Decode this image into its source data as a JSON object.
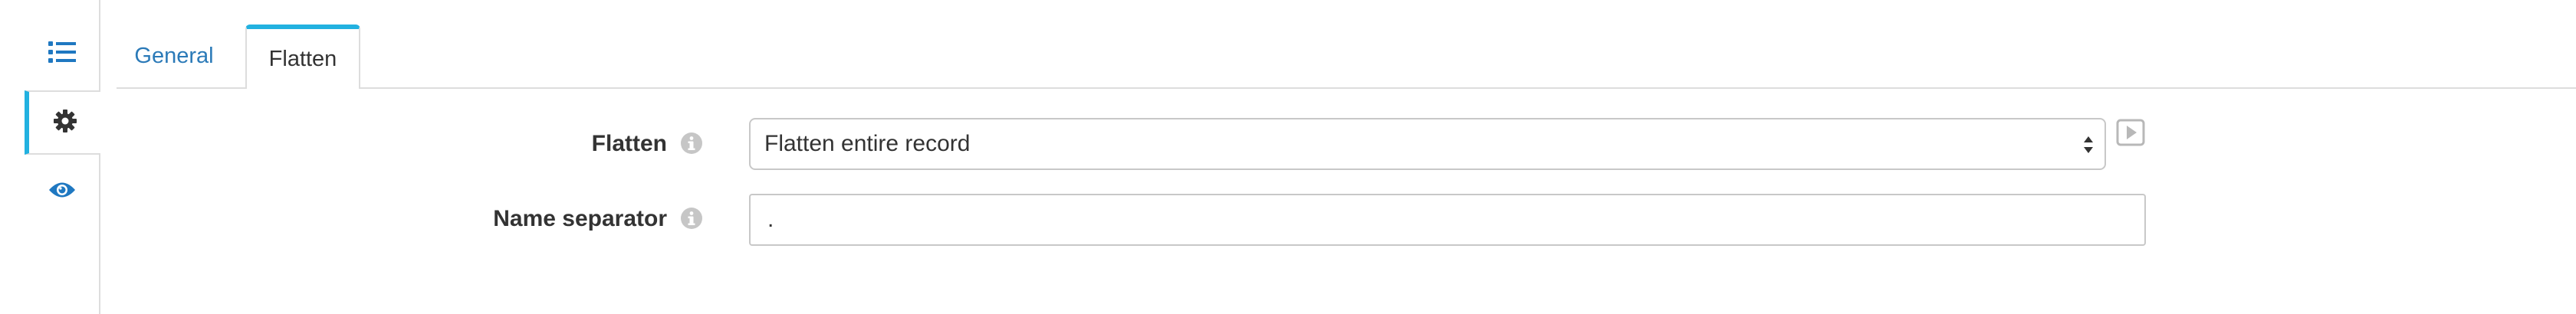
{
  "sidebar": {
    "items": [
      {
        "icon": "list-icon",
        "active": false
      },
      {
        "icon": "gear-icon",
        "active": true
      },
      {
        "icon": "eye-icon",
        "active": false
      }
    ]
  },
  "tabs": [
    {
      "label": "General",
      "active": false
    },
    {
      "label": "Flatten",
      "active": true
    }
  ],
  "form": {
    "flatten": {
      "label": "Flatten",
      "value": "Flatten entire record"
    },
    "name_separator": {
      "label": "Name separator",
      "value": "."
    }
  },
  "colors": {
    "accent": "#22b1e0",
    "link": "#2b7ab8",
    "icon": "#1f78c1"
  }
}
